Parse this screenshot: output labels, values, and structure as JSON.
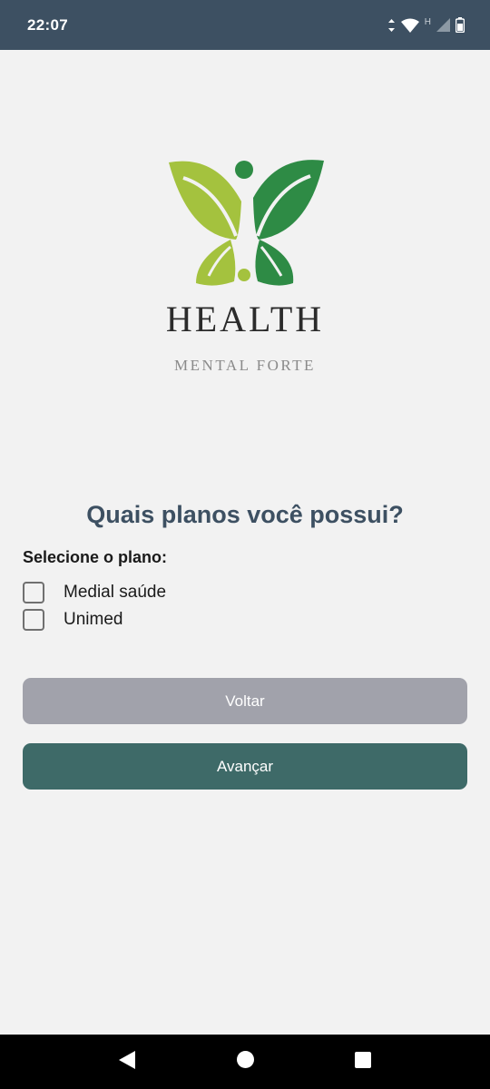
{
  "status_bar": {
    "time": "22:07",
    "icons": [
      "data-arrows-icon",
      "wifi-icon",
      "signal-icon",
      "battery-icon"
    ],
    "network_letter": "H"
  },
  "logo": {
    "brand_name": "HEALTH",
    "tagline": "MENTAL FORTE",
    "colors": {
      "leaf_light": "#a4c23e",
      "leaf_dark": "#2e8b45"
    }
  },
  "form": {
    "question": "Quais planos você possui?",
    "select_label": "Selecione o plano:",
    "options": [
      {
        "label": "Medial saúde",
        "checked": false
      },
      {
        "label": "Unimed",
        "checked": false
      }
    ]
  },
  "buttons": {
    "back_label": "Voltar",
    "next_label": "Avançar"
  },
  "colors": {
    "header_bg": "#3d5062",
    "question_text": "#3d5062",
    "back_button": "#a1a2ab",
    "next_button": "#3e6a68",
    "background": "#f2f2f2"
  },
  "nav_bar": {
    "icons": [
      "back-triangle-icon",
      "home-circle-icon",
      "recents-square-icon"
    ]
  }
}
